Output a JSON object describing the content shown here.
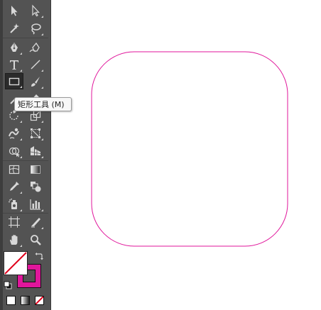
{
  "tooltip": {
    "text": "矩形工具 (M)"
  },
  "canvas": {
    "artboard_color": "#ffffff",
    "shape": {
      "type": "rounded-rectangle",
      "stroke": "#e0169b",
      "fill": "none"
    }
  },
  "toolbar": {
    "background": "#535353",
    "selected_tool": "rectangle-tool",
    "tools": [
      "selection-tool",
      "direct-selection-tool",
      "magic-wand-tool",
      "lasso-tool",
      "pen-tool",
      "curvature-tool",
      "type-tool",
      "line-segment-tool",
      "rectangle-tool",
      "paintbrush-tool",
      "shaper-tool",
      "eraser-tool",
      "rotate-tool",
      "scale-tool",
      "warp-tool",
      "free-transform-tool",
      "shape-builder-tool",
      "perspective-grid-tool",
      "mesh-tool",
      "gradient-tool",
      "eyedropper-tool",
      "blend-tool",
      "symbol-sprayer-tool",
      "column-graph-tool",
      "artboard-tool",
      "slice-tool",
      "hand-tool",
      "zoom-tool"
    ]
  },
  "colors": {
    "fill": "none",
    "stroke": "#e0169b",
    "none_slash": "#e0001b"
  },
  "draw_modes": [
    "color",
    "gradient",
    "none"
  ]
}
